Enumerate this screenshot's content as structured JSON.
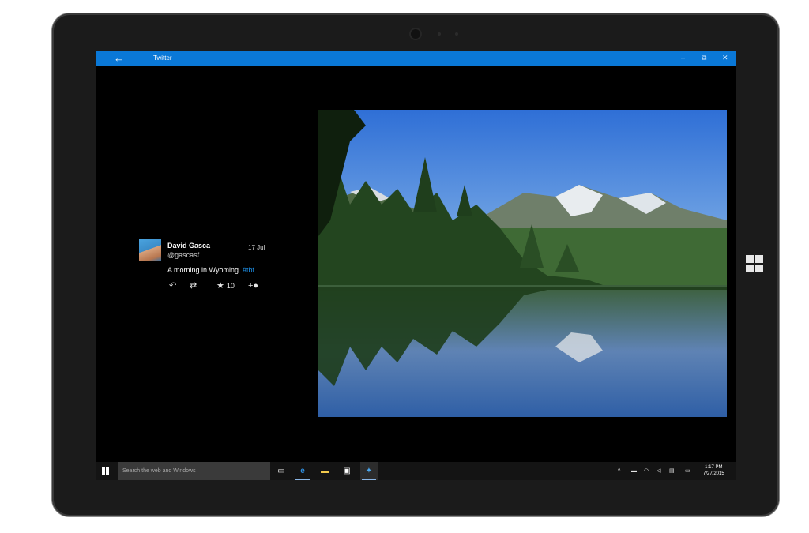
{
  "window": {
    "title": "Twitter",
    "back_icon": "back-arrow-icon",
    "controls": [
      "–",
      "⧉",
      "✕"
    ]
  },
  "tweet": {
    "author_name": "David Gasca",
    "handle": "@gascasf",
    "date": "17 Jul",
    "text": "A morning in Wyoming.",
    "hashtag": "#tbf",
    "favorite_count": "10",
    "actions": {
      "reply_icon": "reply-icon",
      "retweet_icon": "retweet-icon",
      "favorite_icon": "star-icon",
      "follow_icon": "add-user-icon"
    }
  },
  "taskbar": {
    "search_placeholder": "Search the web and Windows",
    "time": "1:17 PM",
    "date": "7/27/2015",
    "pinned_icons": [
      "task-view-icon",
      "edge-icon",
      "file-explorer-icon",
      "store-icon",
      "twitter-icon"
    ]
  },
  "colors": {
    "accent": "#0a78d7",
    "hashtag": "#1d8fe6",
    "background": "#000000"
  }
}
